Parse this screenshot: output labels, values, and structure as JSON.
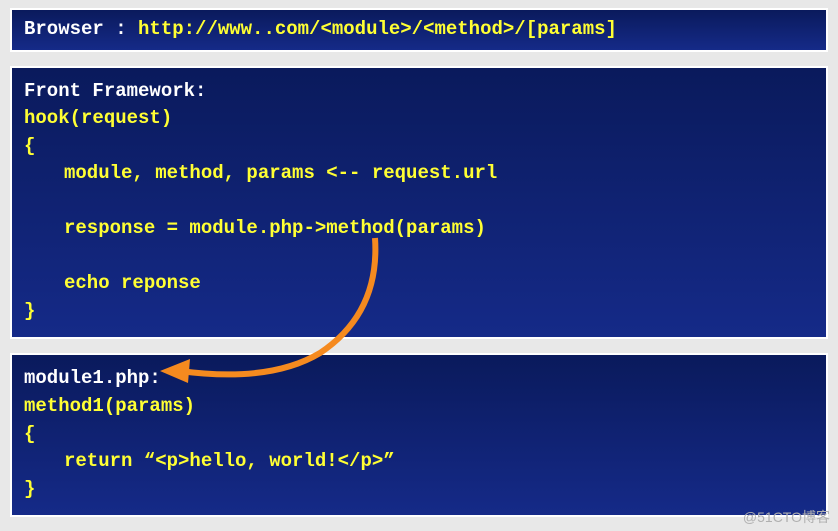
{
  "box1": {
    "label": "Browser : ",
    "url": "http://www..com/<module>/<method>/[params]"
  },
  "box2": {
    "title": "Front Framework:",
    "func": "hook(request)",
    "brace_open": "{",
    "line1": "module, method, params <-- request.url",
    "line2": "response = module.php->method(params)",
    "line3": "echo reponse",
    "brace_close": "}"
  },
  "box3": {
    "title": "module1.php:",
    "func": "method1(params)",
    "brace_open": "{",
    "line1": "return “<p>hello, world!</p>”",
    "brace_close": "}"
  },
  "watermark": "@51CTO博客"
}
